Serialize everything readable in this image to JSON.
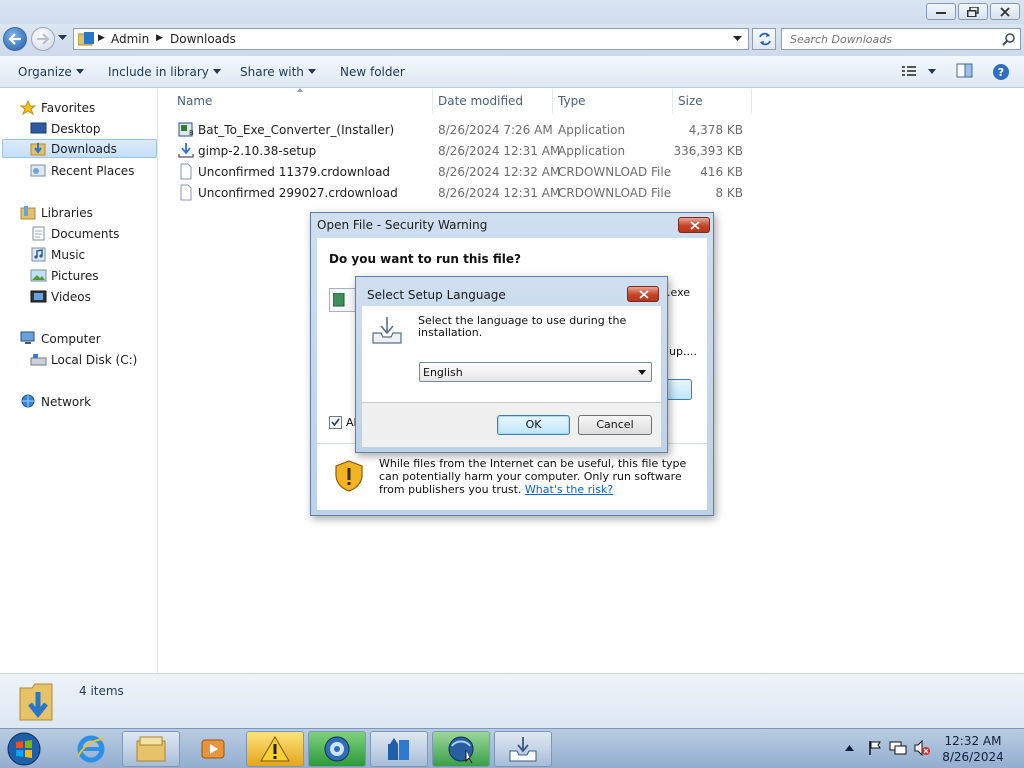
{
  "window": {
    "minimize_icon": "minimize-icon",
    "maximize_icon": "restore-icon",
    "close_icon": "close-icon"
  },
  "address": {
    "crumbs": [
      "Admin",
      "Downloads"
    ],
    "search_placeholder": "Search Downloads"
  },
  "toolbar": {
    "organize": "Organize",
    "include": "Include in library",
    "share": "Share with",
    "newfolder": "New folder"
  },
  "nav": {
    "favorites": "Favorites",
    "desktop": "Desktop",
    "downloads": "Downloads",
    "recent": "Recent Places",
    "libraries": "Libraries",
    "documents": "Documents",
    "music": "Music",
    "pictures": "Pictures",
    "videos": "Videos",
    "computer": "Computer",
    "localdisk": "Local Disk (C:)",
    "network": "Network"
  },
  "columns": {
    "name": "Name",
    "date": "Date modified",
    "type": "Type",
    "size": "Size"
  },
  "files": [
    {
      "name": "Bat_To_Exe_Converter_(Installer)",
      "date": "8/26/2024 7:26 AM",
      "type": "Application",
      "size": "4,378 KB"
    },
    {
      "name": "gimp-2.10.38-setup",
      "date": "8/26/2024 12:31 AM",
      "type": "Application",
      "size": "336,393 KB"
    },
    {
      "name": "Unconfirmed 11379.crdownload",
      "date": "8/26/2024 12:32 AM",
      "type": "CRDOWNLOAD File",
      "size": "416 KB"
    },
    {
      "name": "Unconfirmed 299027.crdownload",
      "date": "8/26/2024 12:31 AM",
      "type": "CRDOWNLOAD File",
      "size": "8 KB"
    }
  ],
  "status": {
    "count": "4 items"
  },
  "security_dialog": {
    "title": "Open File - Security Warning",
    "question": "Do you want to run this file?",
    "partial_ext": ".exe",
    "partial_publisher": "up....",
    "partial_checkbox": "Alw",
    "warning_text": "While files from the Internet can be useful, this file type can potentially harm your computer. Only run software from publishers you trust.",
    "risk_link": "What's the risk?"
  },
  "language_dialog": {
    "title": "Select Setup Language",
    "prompt": "Select the language to use during the installation.",
    "selected": "English",
    "ok": "OK",
    "cancel": "Cancel"
  },
  "clock": {
    "time": "12:32 AM",
    "date": "8/26/2024"
  },
  "colors": {
    "accent": "#1e395b",
    "selection": "#c6dff8",
    "link": "#0066cc"
  }
}
